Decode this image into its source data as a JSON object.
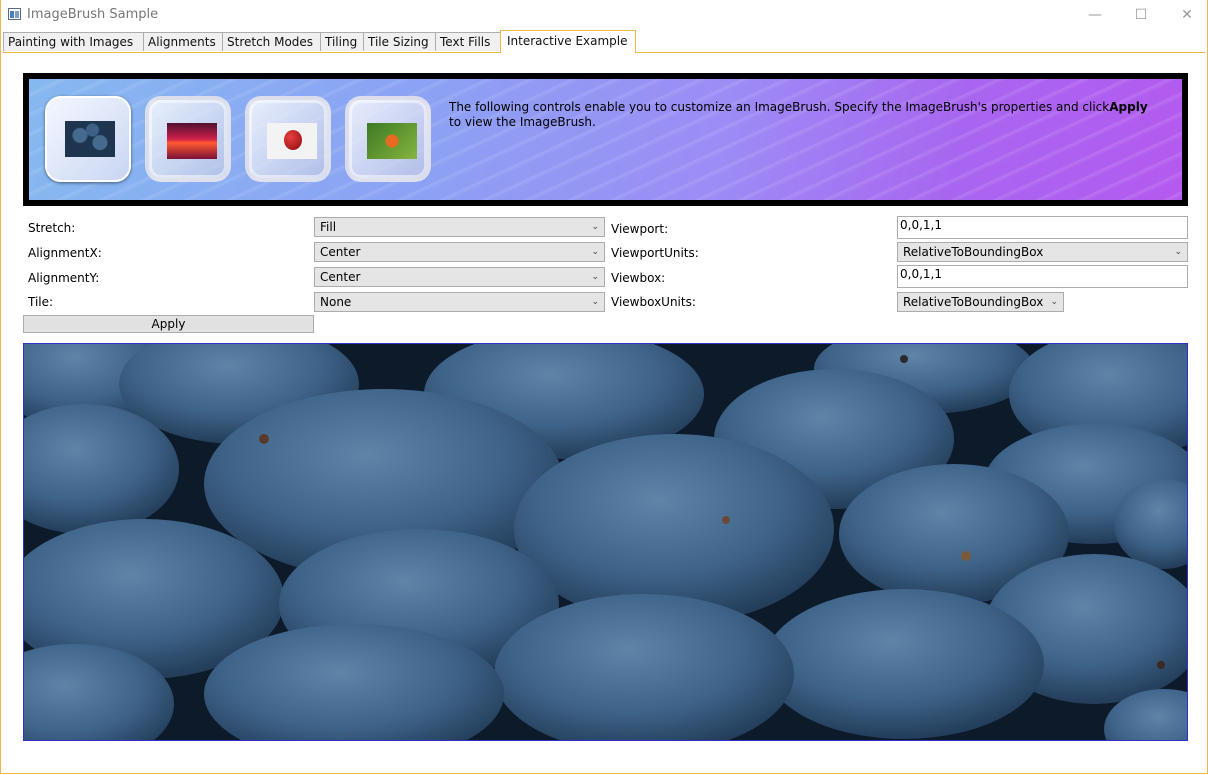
{
  "window": {
    "title": "ImageBrush Sample",
    "controls": {
      "minimize": "—",
      "maximize": "☐",
      "close": "✕"
    },
    "app_icon": "window-app-icon"
  },
  "tabs": [
    {
      "label": "Painting with Images",
      "active": false
    },
    {
      "label": "Alignments",
      "active": false
    },
    {
      "label": "Stretch Modes",
      "active": false
    },
    {
      "label": "Tiling",
      "active": false
    },
    {
      "label": "Tile Sizing",
      "active": false
    },
    {
      "label": "Text Fills",
      "active": false
    },
    {
      "label": "Interactive Example",
      "active": true
    }
  ],
  "banner": {
    "text_before": "The following controls enable you to customize an ImageBrush. Specify the ImageBrush's properties and click",
    "text_bold": "Apply",
    "text_after": " to view the ImageBrush.",
    "thumbnails": [
      {
        "name": "blueberries",
        "selected": true
      },
      {
        "name": "sunset",
        "selected": false
      },
      {
        "name": "apple",
        "selected": false
      },
      {
        "name": "flower",
        "selected": false
      }
    ]
  },
  "form": {
    "stretch": {
      "label": "Stretch:",
      "value": "Fill"
    },
    "alignment_x": {
      "label": "AlignmentX:",
      "value": "Center"
    },
    "alignment_y": {
      "label": "AlignmentY:",
      "value": "Center"
    },
    "tile": {
      "label": "Tile:",
      "value": "None"
    },
    "viewport": {
      "label": "Viewport:",
      "value": "0,0,1,1"
    },
    "viewport_units": {
      "label": "ViewportUnits:",
      "value": "RelativeToBoundingBox"
    },
    "viewbox": {
      "label": "Viewbox:",
      "value": "0,0,1,1"
    },
    "viewbox_units": {
      "label": "ViewboxUnits:",
      "value": "RelativeToBoundingBox"
    },
    "apply_label": "Apply"
  },
  "colors": {
    "accent_border": "#f0b848",
    "preview_border": "#3030c8",
    "banner_start": "#86b8f0",
    "banner_end": "#b45aef"
  }
}
